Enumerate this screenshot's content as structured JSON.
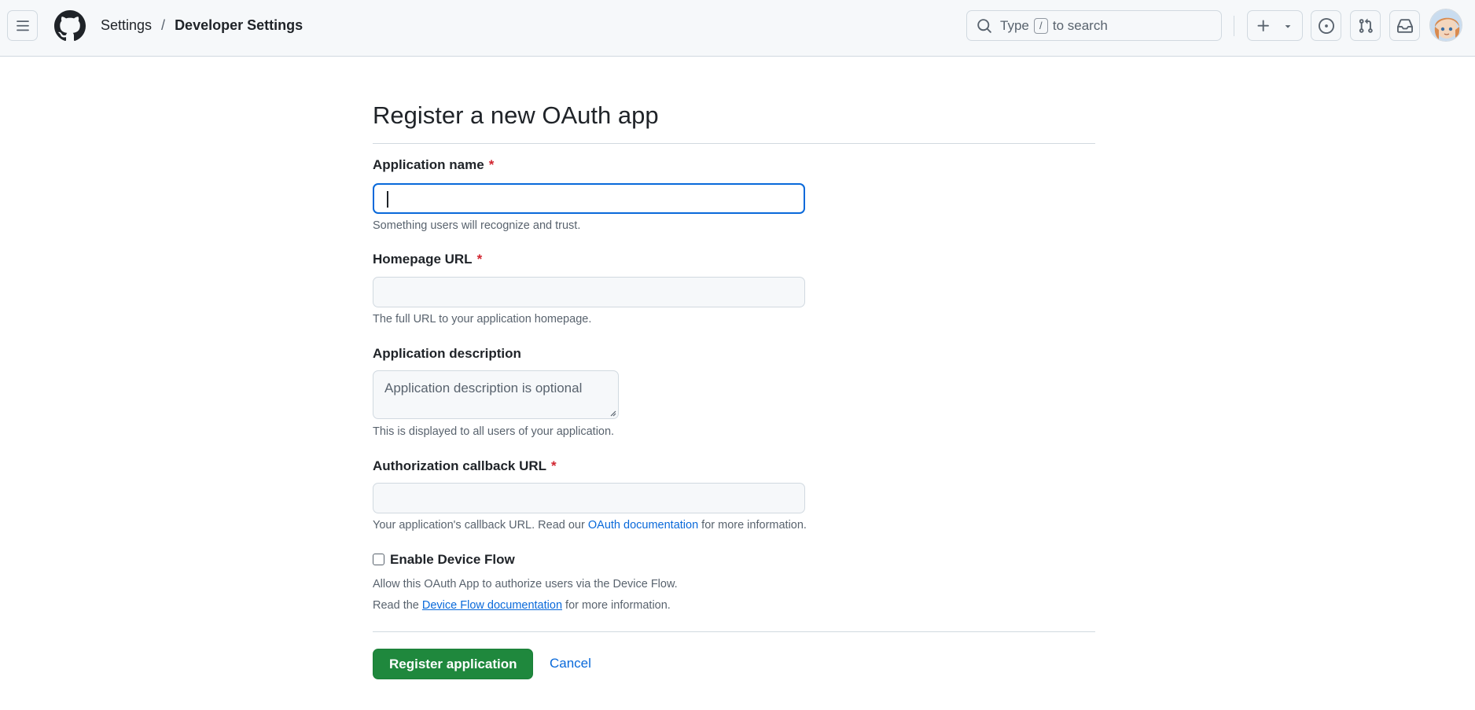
{
  "header": {
    "breadcrumb": {
      "parent": "Settings",
      "separator": "/",
      "current": "Developer Settings"
    },
    "search": {
      "before_key": "Type",
      "key": "/",
      "after_key": "to search"
    },
    "icons": {
      "menu": "hamburger-menu-icon",
      "logo": "github-logo",
      "search": "search-icon",
      "create": "plus-icon",
      "create_caret": "triangle-down-icon",
      "issues": "issue-opened-icon",
      "pulls": "git-pull-request-icon",
      "inbox": "inbox-icon"
    }
  },
  "form": {
    "title": "Register a new OAuth app",
    "app_name": {
      "label": "Application name",
      "required_mark": "*",
      "value": "",
      "help": "Something users will recognize and trust."
    },
    "homepage": {
      "label": "Homepage URL",
      "required_mark": "*",
      "value": "",
      "help": "The full URL to your application homepage."
    },
    "description": {
      "label": "Application description",
      "placeholder": "Application description is optional",
      "help": "This is displayed to all users of your application."
    },
    "callback": {
      "label": "Authorization callback URL",
      "required_mark": "*",
      "value": "",
      "help_before": "Your application's callback URL. Read our",
      "help_link": "OAuth documentation",
      "help_after": "for more information."
    },
    "device_flow": {
      "label": "Enable Device Flow",
      "checked": false,
      "help_line1": "Allow this OAuth App to authorize users via the Device Flow.",
      "help_line2_before": "Read the",
      "help_line2_link": "Device Flow documentation",
      "help_line2_after": "for more information."
    },
    "submit_label": "Register application",
    "cancel_label": "Cancel"
  },
  "colors": {
    "primary_button": "#1f883d",
    "link": "#0969da",
    "required": "#d1242f",
    "focus_border": "#0969da"
  }
}
